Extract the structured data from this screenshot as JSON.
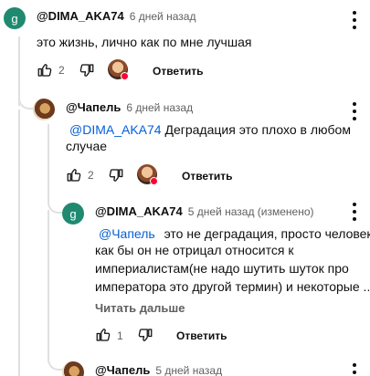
{
  "comments": [
    {
      "author": "@DIMA_AKA74",
      "time": "6 дней назад",
      "avatar_letter": "g",
      "text": "это жизнь, лично как по мне лучшая",
      "likes": "2",
      "reply_label": "Ответить"
    },
    {
      "author": "@Чапель",
      "time": "6 дней назад",
      "mention": "@DIMA_AKA74",
      "text_line1": "Деградация это плохо  в любом",
      "text_line2": "случае",
      "likes": "2",
      "reply_label": "Ответить"
    },
    {
      "author": "@DIMA_AKA74",
      "time": "5 дней назад (изменено)",
      "avatar_letter": "g",
      "mention": "@Чапель",
      "text_line1": "это не деградация, просто человек",
      "text_line2": "как бы он не отрицал относится к",
      "text_line3": "империалистам(не надо шутить шуток про",
      "text_line4": "императора это другой термин) и некоторые ...",
      "read_more": "Читать дальше",
      "likes": "1",
      "reply_label": "Ответить"
    },
    {
      "author": "@Чапель",
      "time": "5 дней назад"
    }
  ],
  "colors": {
    "mention": "#065fd4",
    "creator_heart": "#ff0033",
    "avatar_letter_bg": "#1f8a70"
  },
  "icons": [
    "thumb-up-icon",
    "thumb-down-icon",
    "more-vert-icon",
    "creator-heart-icon"
  ]
}
